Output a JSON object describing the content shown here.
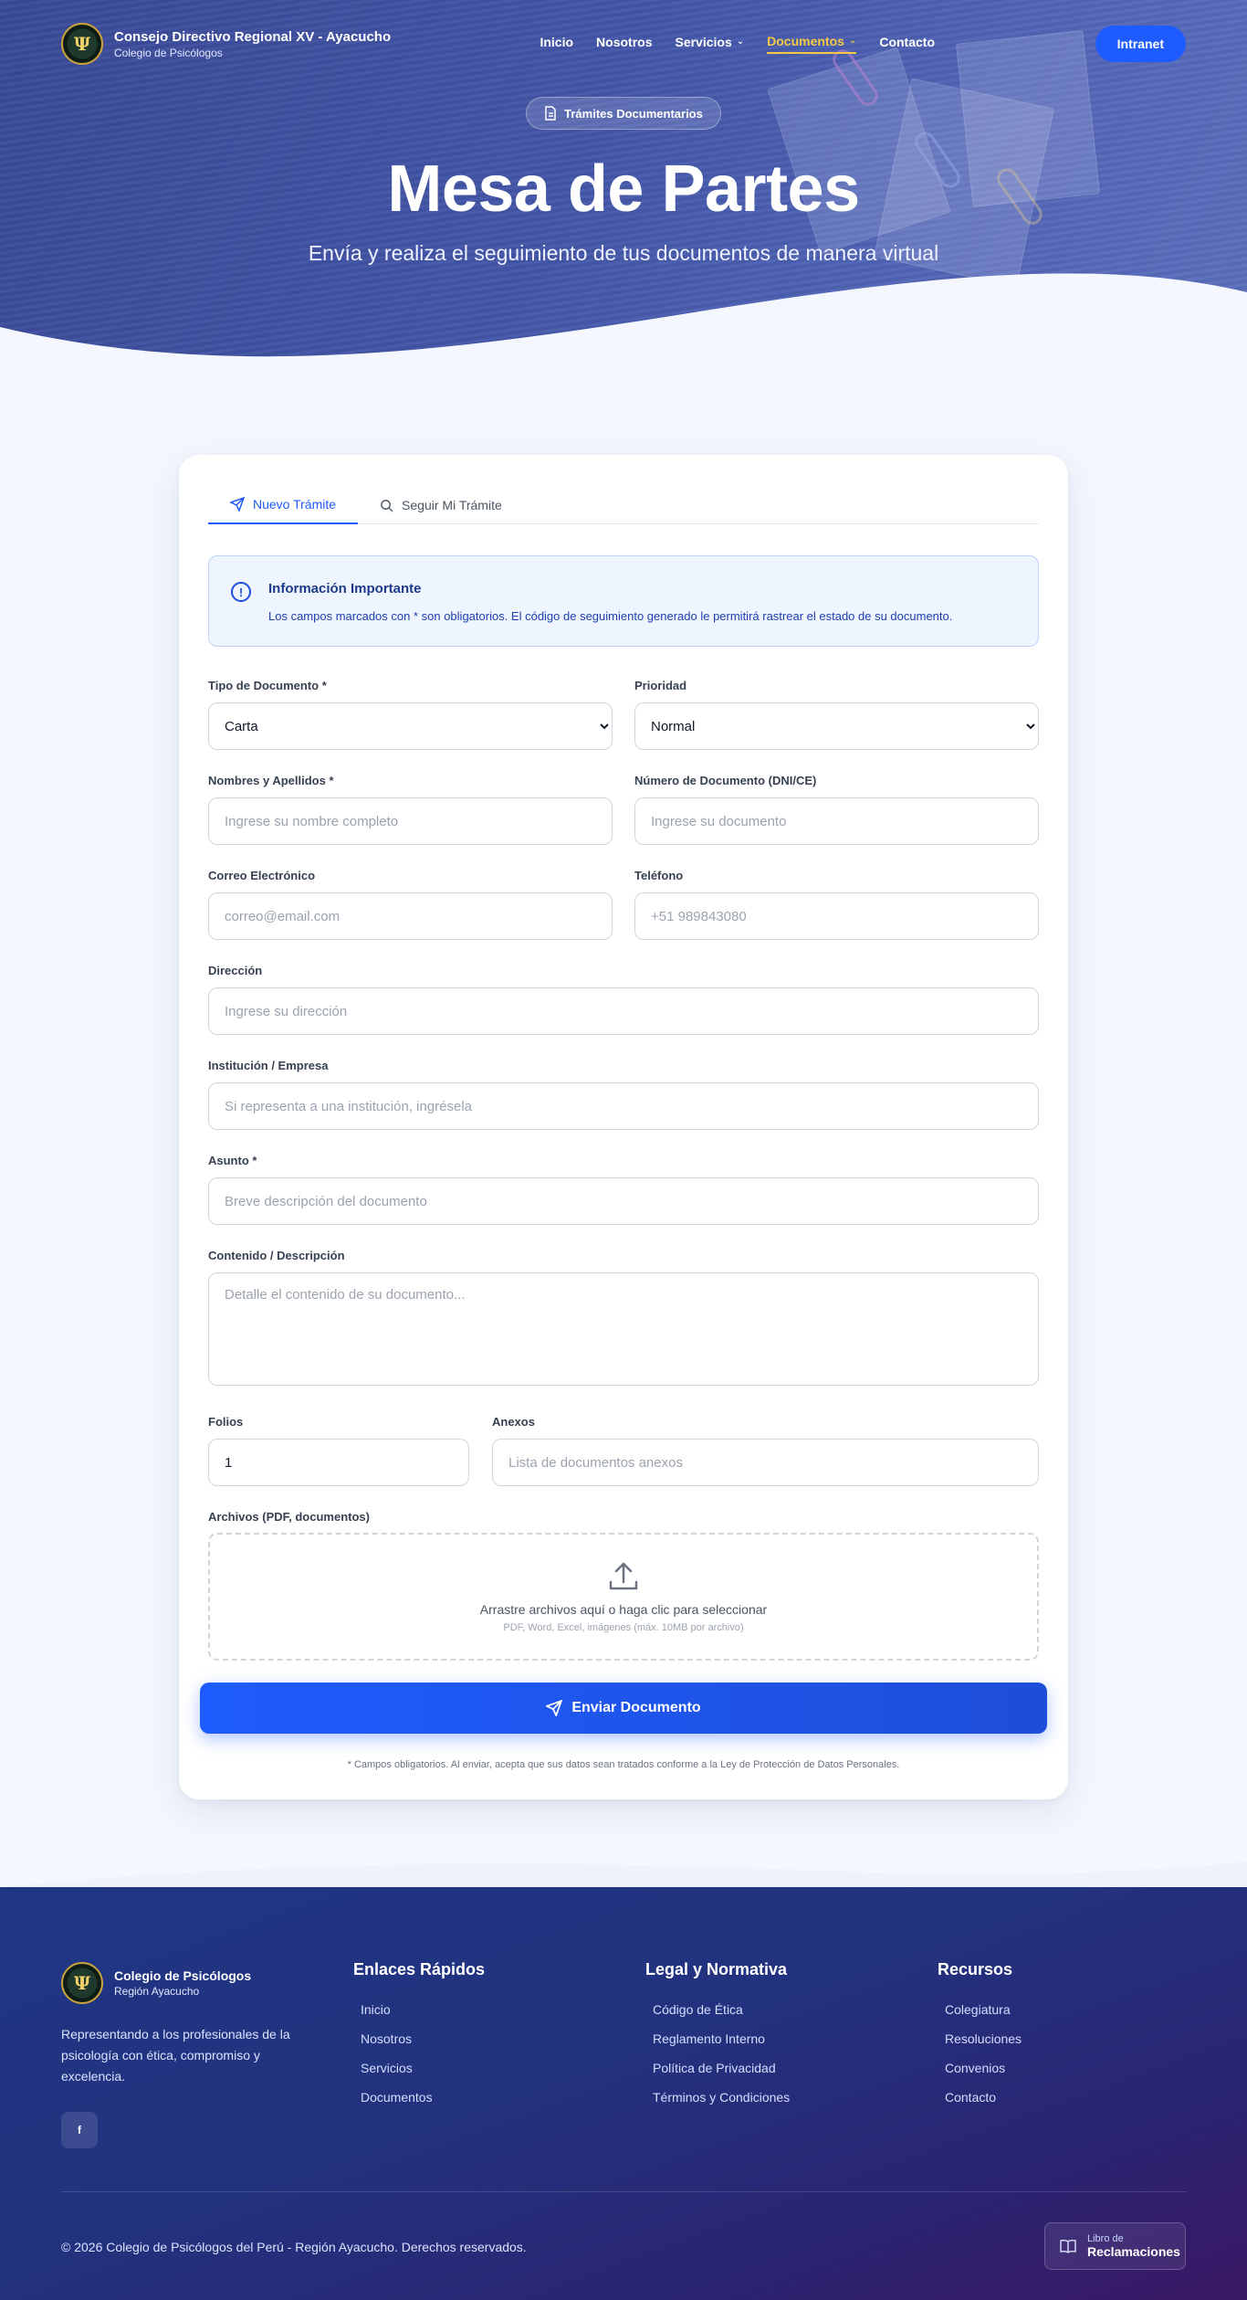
{
  "header": {
    "brand_title": "Consejo Directivo Regional XV - Ayacucho",
    "brand_subtitle": "Colegio de Psicólogos",
    "nav": [
      {
        "label": "Inicio"
      },
      {
        "label": "Nosotros"
      },
      {
        "label": "Servicios",
        "has_dropdown": true
      },
      {
        "label": "Documentos",
        "has_dropdown": true,
        "active": true
      },
      {
        "label": "Contacto"
      }
    ],
    "intranet_label": "Intranet"
  },
  "hero": {
    "badge": "Trámites Documentarios",
    "title": "Mesa de Partes",
    "subtitle": "Envía y realiza el seguimiento de tus documentos de manera virtual"
  },
  "tabs": [
    {
      "label": "Nuevo Trámite",
      "active": true
    },
    {
      "label": "Seguir Mi Trámite",
      "active": false
    }
  ],
  "info": {
    "title": "Información Importante",
    "text": "Los campos marcados con * son obligatorios. El código de seguimiento generado le permitirá rastrear el estado de su documento."
  },
  "form": {
    "tipo_documento": {
      "label": "Tipo de Documento *",
      "value": "Carta"
    },
    "prioridad": {
      "label": "Prioridad",
      "value": "Normal"
    },
    "nombres": {
      "label": "Nombres y Apellidos *",
      "placeholder": "Ingrese su nombre completo"
    },
    "documento": {
      "label": "Número de Documento (DNI/CE)",
      "placeholder": "Ingrese su documento"
    },
    "correo": {
      "label": "Correo Electrónico",
      "placeholder": "correo@email.com"
    },
    "telefono": {
      "label": "Teléfono",
      "placeholder": "+51 989843080"
    },
    "direccion": {
      "label": "Dirección",
      "placeholder": "Ingrese su dirección"
    },
    "institucion": {
      "label": "Institución / Empresa",
      "placeholder": "Si representa a una institución, ingrésela"
    },
    "asunto": {
      "label": "Asunto *",
      "placeholder": "Breve descripción del documento"
    },
    "contenido": {
      "label": "Contenido / Descripción",
      "placeholder": "Detalle el contenido de su documento..."
    },
    "folios": {
      "label": "Folios",
      "value": "1"
    },
    "anexos": {
      "label": "Anexos",
      "placeholder": "Lista de documentos anexos"
    },
    "archivos": {
      "label": "Archivos (PDF, documentos)",
      "drop_text": "Arrastre archivos aquí o haga clic para seleccionar",
      "drop_hint": "PDF, Word, Excel, imágenes (máx. 10MB por archivo)"
    },
    "submit_label": "Enviar Documento",
    "disclaimer": "* Campos obligatorios. Al enviar, acepta que sus datos sean tratados conforme a la Ley de Protección de Datos Personales."
  },
  "footer": {
    "brand_title": "Colegio de Psicólogos",
    "brand_subtitle": "Región Ayacucho",
    "description": "Representando a los profesionales de la psicología con ética, compromiso y excelencia.",
    "social_facebook": "f",
    "columns": [
      {
        "title": "Enlaces Rápidos",
        "links": [
          "Inicio",
          "Nosotros",
          "Servicios",
          "Documentos"
        ]
      },
      {
        "title": "Legal y Normativa",
        "links": [
          "Código de Ética",
          "Reglamento Interno",
          "Política de Privacidad",
          "Términos y Condiciones"
        ]
      },
      {
        "title": "Recursos",
        "links": [
          "Colegiatura",
          "Resoluciones",
          "Convenios",
          "Contacto"
        ]
      }
    ],
    "copyright": "© 2026 Colegio de Psicólogos del Perú - Región Ayacucho. Derechos reservados.",
    "book_small": "Libro de",
    "book_big": "Reclamaciones"
  },
  "colors": {
    "primary": "#1f5cff",
    "nav_active": "#f6c945",
    "hero_bg": "#4356a8",
    "footer_bg": "#23327e"
  }
}
